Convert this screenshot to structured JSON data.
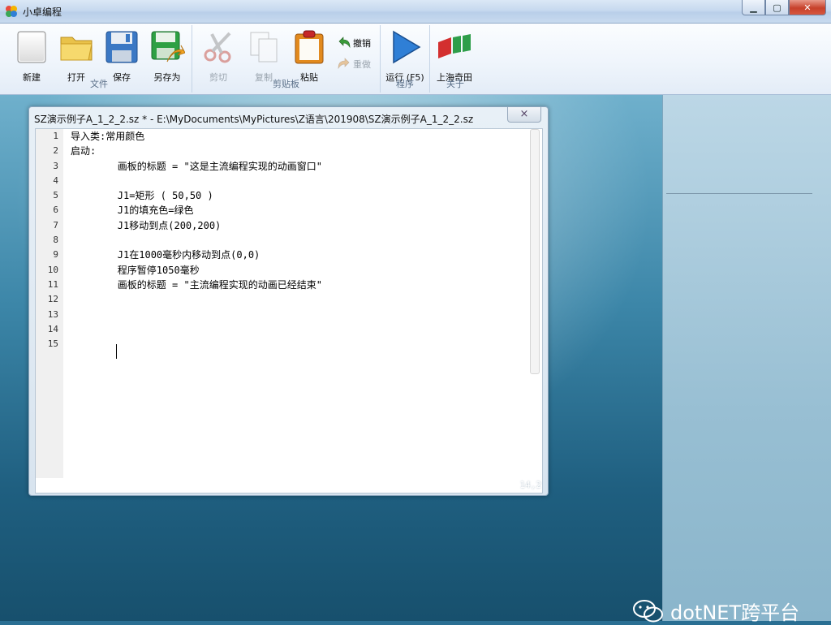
{
  "window": {
    "title": "小卓编程",
    "min": "▁",
    "max": "▢",
    "close": "✕"
  },
  "ribbon": {
    "groups": {
      "file": {
        "label": "文件",
        "new": "新建",
        "open": "打开",
        "save": "保存",
        "save_as": "另存为"
      },
      "clipboard": {
        "label": "剪贴板",
        "cut": "剪切",
        "copy": "复制",
        "paste": "粘贴",
        "undo": "撤销",
        "redo": "重做"
      },
      "program": {
        "label": "程序",
        "run": "运行 (F5)"
      },
      "about": {
        "label": "关于",
        "brand": "上海奇田"
      }
    }
  },
  "editor_window": {
    "title": "SZ演示例子A_1_2_2.sz * - E:\\MyDocuments\\MyPictures\\Z语言\\201908\\SZ演示例子A_1_2_2.sz",
    "close": "×",
    "cursor_position": "14,2",
    "line_numbers": [
      "1",
      "2",
      "3",
      "4",
      "5",
      "6",
      "7",
      "8",
      "9",
      "10",
      "11",
      "12",
      "13",
      "14",
      "15"
    ],
    "lines": [
      "导入类:常用颜色",
      "启动:",
      "        画板的标题 = \"这是主流编程实现的动画窗口\"",
      "",
      "        J1=矩形 ( 50,50 )",
      "        J1的填充色=绿色",
      "        J1移动到点(200,200)",
      "",
      "        J1在1000毫秒内移动到点(0,0)",
      "        程序暂停1050毫秒",
      "        画板的标题 = \"主流编程实现的动画已经结束\"",
      "",
      "",
      "",
      ""
    ]
  },
  "watermark": {
    "text": "dotNET跨平台"
  },
  "colors": {
    "accent_blue": "#2f7fd6",
    "save_green": "#2ea043",
    "brand_red": "#d32f2f"
  }
}
